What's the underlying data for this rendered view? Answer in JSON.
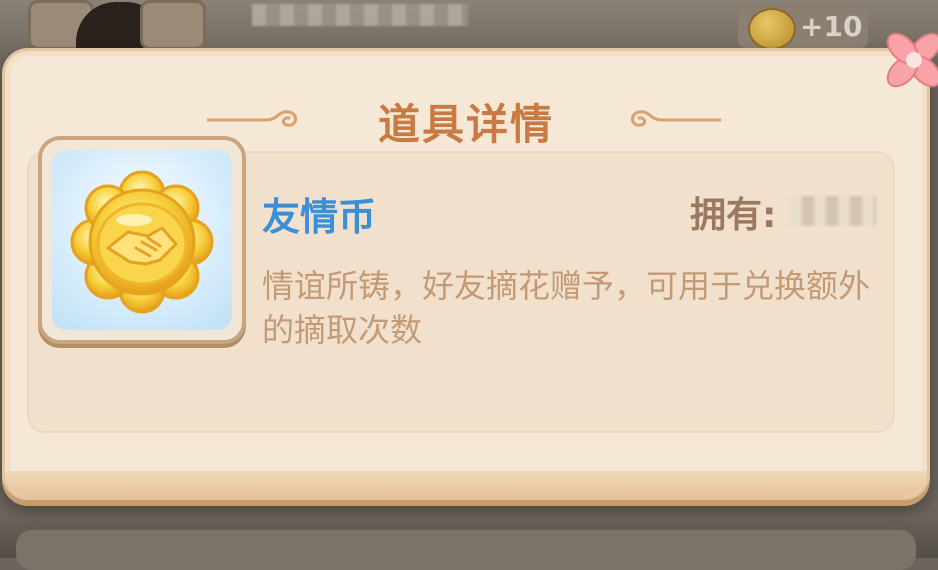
{
  "hud": {
    "coin_icon": "honeycomb-coin-icon",
    "bonus_text": "+10"
  },
  "dialog": {
    "title": "道具详情",
    "item": {
      "name": "友情币",
      "icon": "friendship-coin-icon",
      "owned_label": "拥有:",
      "owned_value": "",
      "description": "情谊所铸，好友摘花赠予，可用于兑换额外的摘取次数"
    },
    "close_icon": "close-flower-icon"
  },
  "colors": {
    "title": "#c97a42",
    "item_name": "#3a8fd8",
    "description": "#c49a76",
    "panel": "#f5e8d6"
  }
}
